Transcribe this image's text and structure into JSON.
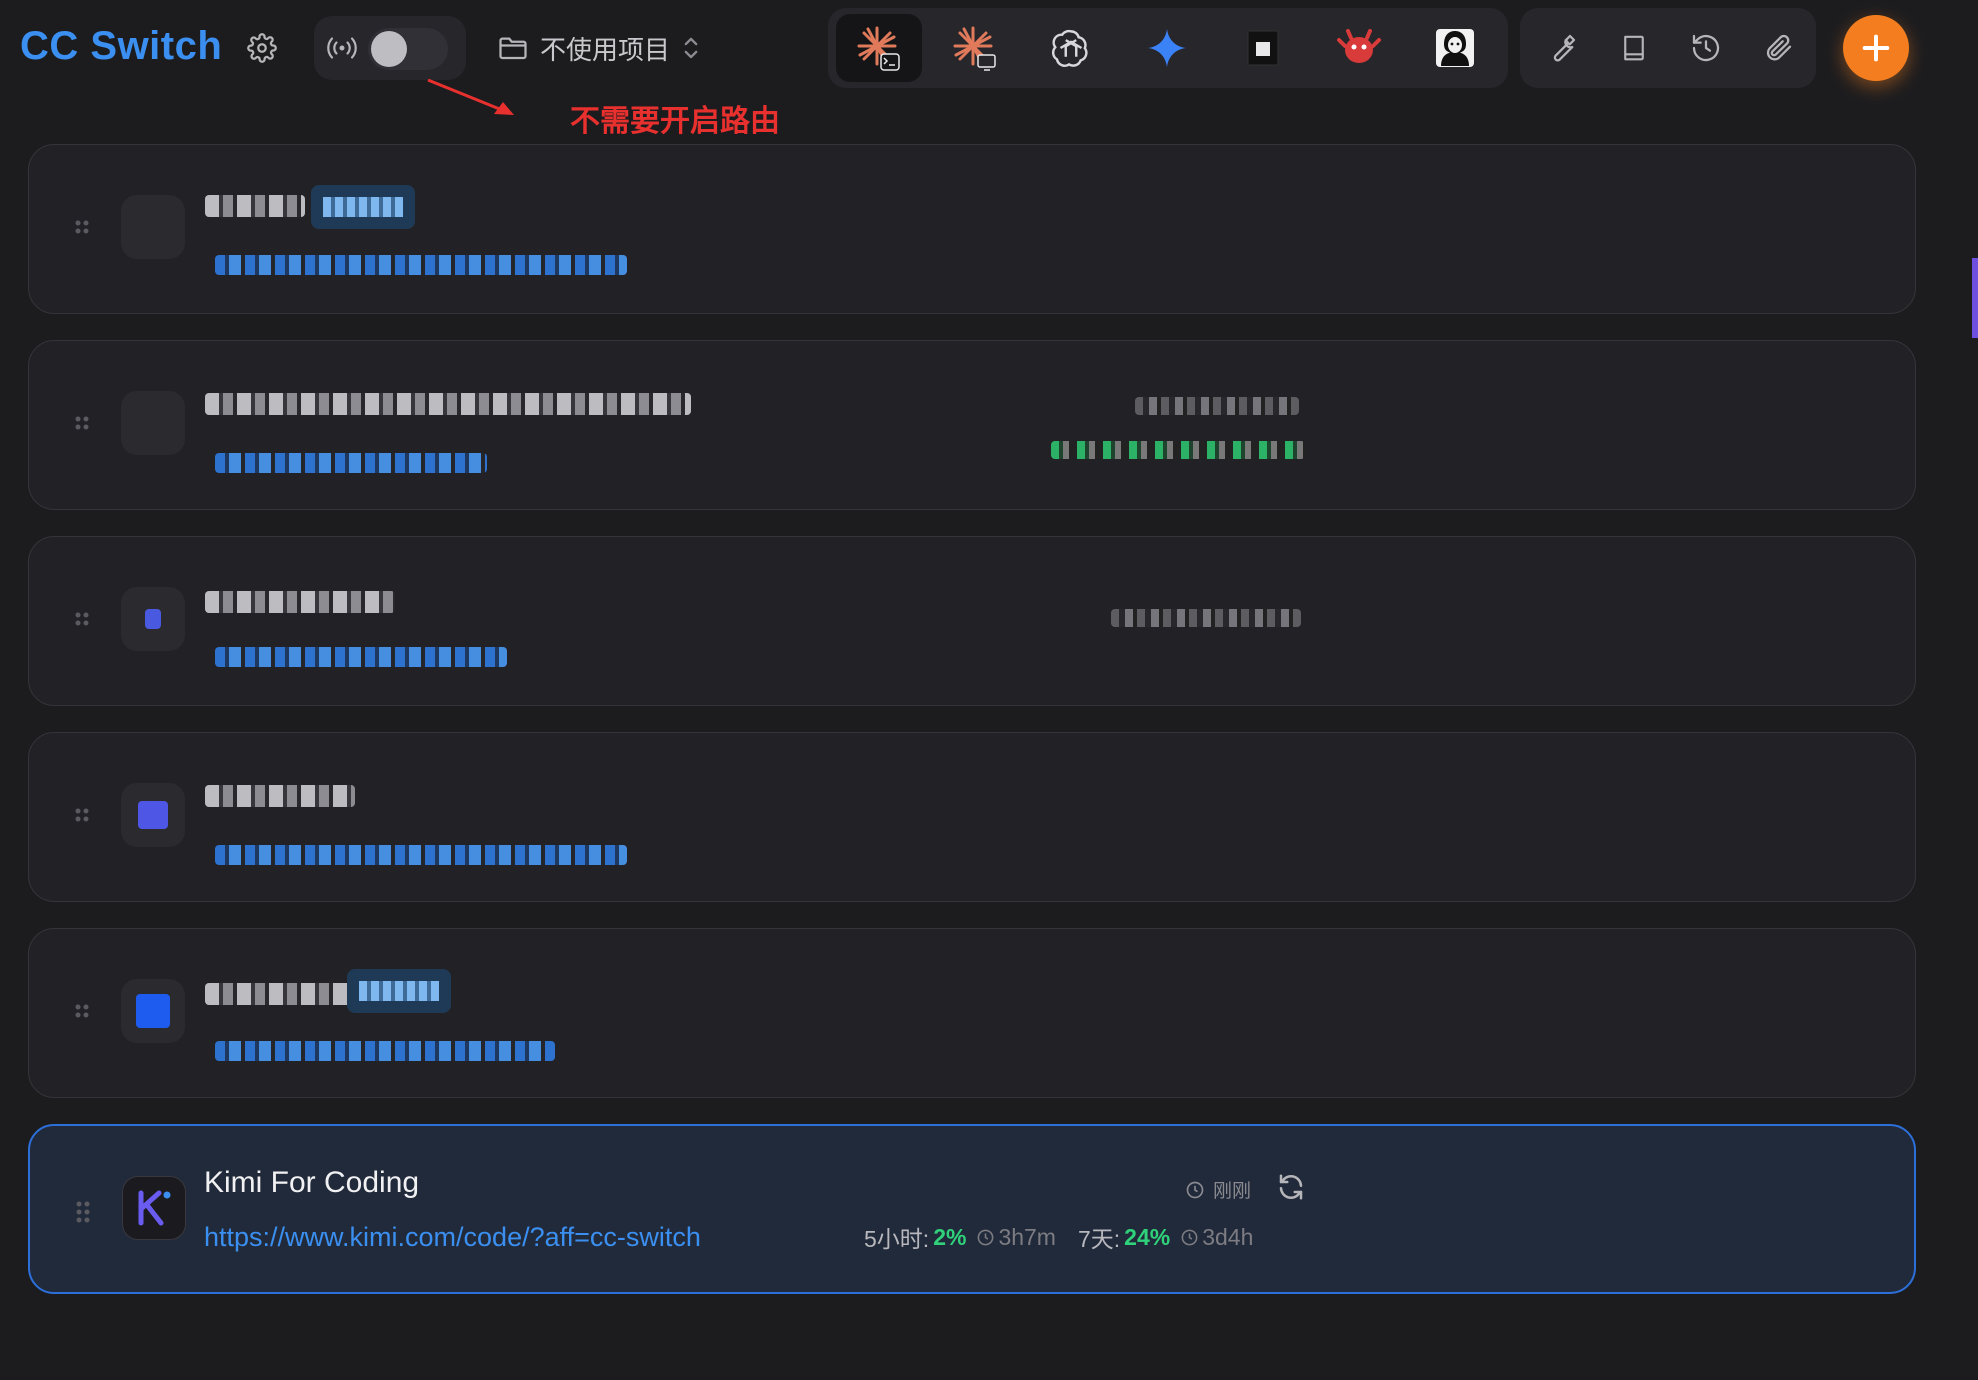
{
  "header": {
    "title": "CC Switch",
    "project_label": "不使用项目",
    "annotation": "不需要开启路由"
  },
  "app_tabs": [
    {
      "name": "claude-code",
      "icon": "claude-terminal-icon",
      "active": true
    },
    {
      "name": "claude-desktop",
      "icon": "claude-desktop-icon",
      "active": false
    },
    {
      "name": "codex",
      "icon": "openai-icon",
      "active": false
    },
    {
      "name": "gemini",
      "icon": "gemini-icon",
      "active": false
    },
    {
      "name": "opencode",
      "icon": "square-app-icon",
      "active": false
    },
    {
      "name": "openclaw",
      "icon": "red-creature-icon",
      "active": false
    },
    {
      "name": "avatar-app",
      "icon": "avatar-app-icon",
      "active": false
    }
  ],
  "tools": [
    {
      "name": "tools",
      "icon": "wrench-icon"
    },
    {
      "name": "prompts",
      "icon": "book-icon"
    },
    {
      "name": "history",
      "icon": "history-icon"
    },
    {
      "name": "attachments",
      "icon": "paperclip-icon"
    }
  ],
  "colors": {
    "accent": "#3b8ff0",
    "add_button": "#f47e1f",
    "annotation": "#e8302e",
    "usage_green": "#2fd27a"
  },
  "active_provider": {
    "name": "Kimi For Coding",
    "url": "https://www.kimi.com/code/?aff=cc-switch",
    "last_checked": "刚刚",
    "usage": [
      {
        "label": "5小时:",
        "percent": "2%",
        "reset": "3h7m"
      },
      {
        "label": "7天:",
        "percent": "24%",
        "reset": "3d4h"
      }
    ]
  }
}
